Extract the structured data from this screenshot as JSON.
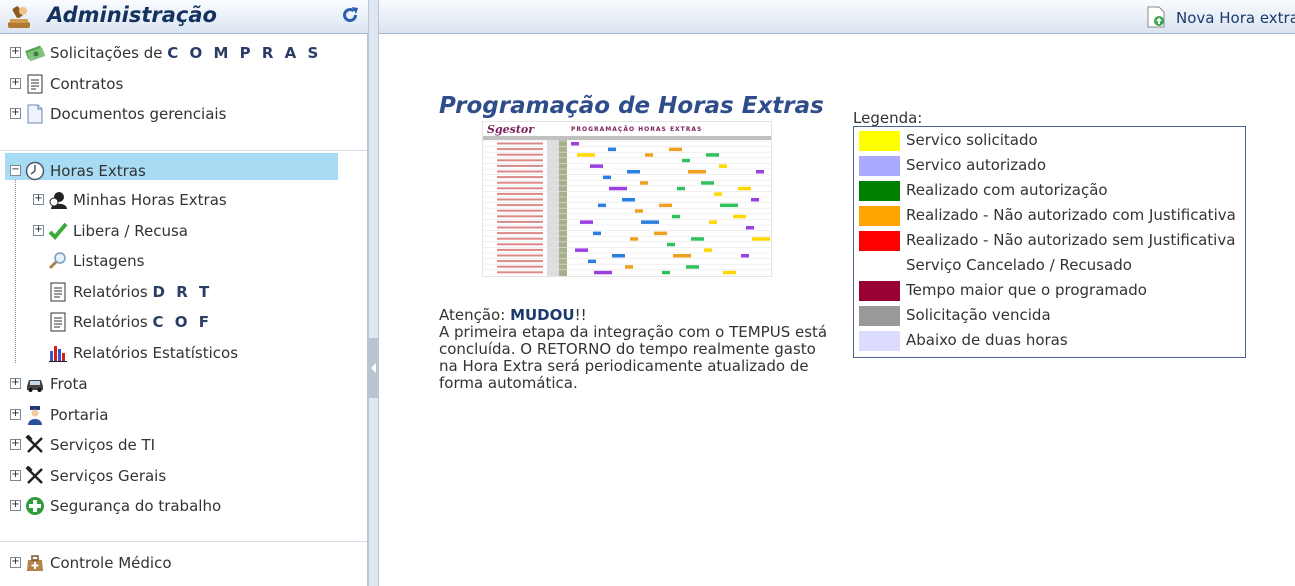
{
  "sidebar": {
    "title": "Administração",
    "groups": [
      {
        "prefix": "Solicitações de",
        "bold": "C O M P R A S",
        "icon": "money-icon"
      },
      {
        "prefix": "Contratos",
        "bold": "",
        "icon": "contract-document-icon"
      },
      {
        "prefix": "Documentos gerenciais",
        "bold": "",
        "icon": "document-icon"
      }
    ],
    "horas_extras": {
      "label": "Horas Extras",
      "children": [
        {
          "prefix": "Minhas Horas Extras",
          "bold": ""
        },
        {
          "prefix": "Libera / Recusa",
          "bold": ""
        },
        {
          "prefix": "Listagens",
          "bold": ""
        },
        {
          "prefix": "Relatórios",
          "bold": "D R T"
        },
        {
          "prefix": "Relatórios",
          "bold": "C O F"
        },
        {
          "prefix": "Relatórios Estatísticos",
          "bold": ""
        }
      ]
    },
    "more": [
      {
        "label": "Frota"
      },
      {
        "label": "Portaria"
      },
      {
        "label": "Serviços de TI"
      },
      {
        "label": "Serviços Gerais"
      },
      {
        "label": "Segurança do trabalho"
      }
    ],
    "footer": {
      "label": "Controle Médico"
    }
  },
  "toolbar": {
    "new_label": "Nova Hora extra"
  },
  "main": {
    "title": "Programação de Horas Extras",
    "notice": {
      "prefix": "Atenção: ",
      "highlight": "MUDOU",
      "suffix": "!!",
      "body": "A primeira etapa da integração com o TEMPUS está concluída. O RETORNO do tempo realmente gasto na Hora Extra será periodicamente atualizado de forma automática."
    },
    "preview": {
      "brand": "Sgestor",
      "heading": "PROGRAMAÇÃO HORAS EXTRAS"
    }
  },
  "legend": {
    "title": "Legenda:",
    "items": [
      {
        "label": "Servico solicitado",
        "color": "#ffff00"
      },
      {
        "label": "Servico autorizado",
        "color": "#aaaaff"
      },
      {
        "label": "Realizado com autorização",
        "color": "#008000"
      },
      {
        "label": "Realizado - Não autorizado com Justificativa",
        "color": "#ffa500"
      },
      {
        "label": "Realizado - Não autorizado sem Justificativa",
        "color": "#ff0000"
      },
      {
        "label": "Serviço Cancelado / Recusado",
        "color": "#ffffff"
      },
      {
        "label": "Tempo maior que o programado",
        "color": "#990033"
      },
      {
        "label": "Solicitação vencida",
        "color": "#999999"
      },
      {
        "label": "Abaixo de duas horas",
        "color": "#dcdcff"
      }
    ]
  }
}
